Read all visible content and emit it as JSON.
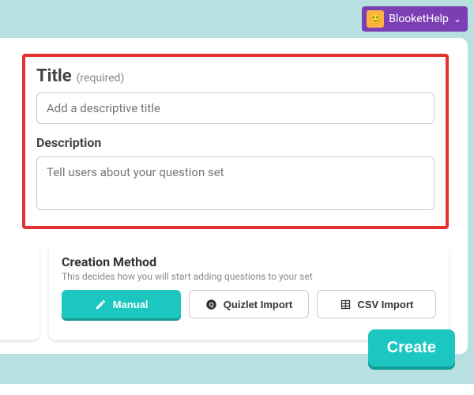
{
  "user": {
    "name": "BlooketHelp",
    "avatar_emoji": "😊"
  },
  "form": {
    "title_label": "Title",
    "title_required": "(required)",
    "title_placeholder": "Add a descriptive title",
    "description_label": "Description",
    "description_placeholder": "Tell users about your question set"
  },
  "creation": {
    "heading": "Creation Method",
    "subheading": "This decides how you will start adding questions to your set",
    "methods": [
      {
        "label": "Manual"
      },
      {
        "label": "Quizlet Import"
      },
      {
        "label": "CSV Import"
      }
    ]
  },
  "actions": {
    "create": "Create"
  }
}
